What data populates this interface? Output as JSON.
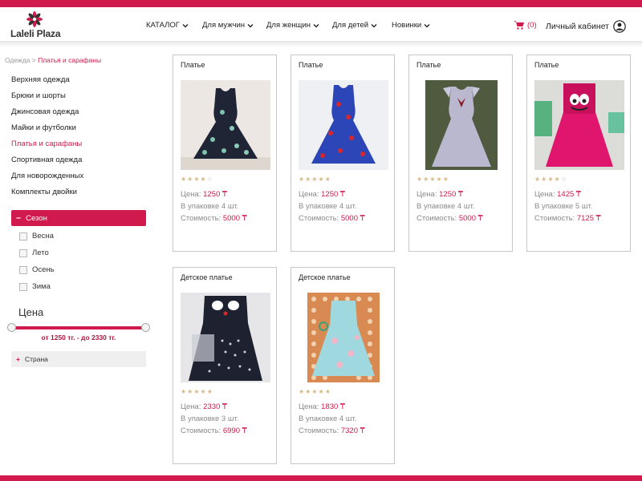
{
  "header": {
    "logo_text": "Laleli Plaza",
    "nav": [
      {
        "label": "КАТАЛОГ"
      },
      {
        "label": "Для мужчин"
      },
      {
        "label": "Для женщин"
      },
      {
        "label": "Для детей"
      },
      {
        "label": "Новинки"
      }
    ],
    "cart_count": "(0)",
    "account_label": "Личный кабинет"
  },
  "breadcrumb": {
    "parent": "Одежда >",
    "current": "Платья и сарафаны"
  },
  "sidebar": {
    "categories": [
      {
        "label": "Верхняя одежда",
        "active": false
      },
      {
        "label": "Брюки и шорты",
        "active": false
      },
      {
        "label": "Джинсовая одежда",
        "active": false
      },
      {
        "label": "Майки и футболки",
        "active": false
      },
      {
        "label": "Платья и сарафаны",
        "active": true
      },
      {
        "label": "Спортивная одежда",
        "active": false
      },
      {
        "label": "Для новорожденных",
        "active": false
      },
      {
        "label": "Комплекты двойки",
        "active": false
      }
    ],
    "season": {
      "label": "Сезон",
      "options": [
        "Весна",
        "Лето",
        "Осень",
        "Зима"
      ]
    },
    "price": {
      "title": "Цена",
      "range_text": "от 1250 тг. - до 2330 тг."
    },
    "country_label": "Страна"
  },
  "products": [
    {
      "title": "Платье",
      "rating": 4,
      "price_label": "Цена:",
      "price": "1250 ₸",
      "pack": "В упаковке 4 шт.",
      "cost_label": "Стоимость:",
      "cost": "5000 ₸",
      "dress": "navy"
    },
    {
      "title": "Платье",
      "rating": 5,
      "price_label": "Цена:",
      "price": "1250 ₸",
      "pack": "В упаковке 4 шт.",
      "cost_label": "Стоимость:",
      "cost": "5000 ₸",
      "dress": "royal"
    },
    {
      "title": "Платье",
      "rating": 5,
      "price_label": "Цена:",
      "price": "1250 ₸",
      "pack": "В упаковке 4 шт.",
      "cost_label": "Стоимость:",
      "cost": "5000 ₸",
      "dress": "floral"
    },
    {
      "title": "Платье",
      "rating": 4,
      "price_label": "Цена:",
      "price": "1425 ₸",
      "pack": "В упаковке 5 шт.",
      "cost_label": "Стоимость:",
      "cost": "7125 ₸",
      "dress": "pink"
    },
    {
      "title": "Детское платье",
      "rating": 5,
      "price_label": "Цена:",
      "price": "2330 ₸",
      "pack": "В упаковке 3 шт.",
      "cost_label": "Стоимость:",
      "cost": "6990 ₸",
      "dress": "dots"
    },
    {
      "title": "Детское платье",
      "rating": 5,
      "price_label": "Цена:",
      "price": "1830 ₸",
      "pack": "В упаковке 4 шт.",
      "cost_label": "Стоимость:",
      "cost": "7320 ₸",
      "dress": "mint"
    }
  ],
  "colors": {
    "accent": "#d01a4d",
    "star": "#d7b98a"
  }
}
